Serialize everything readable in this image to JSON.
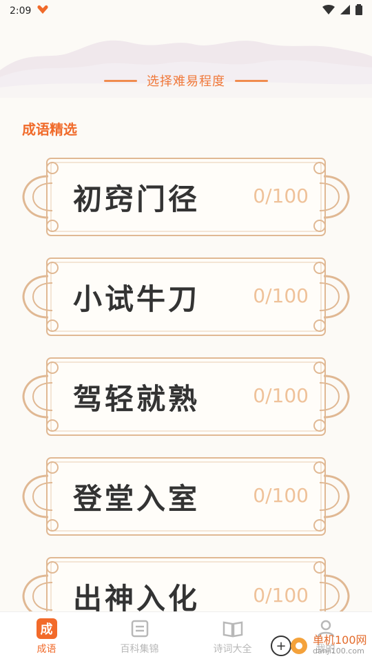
{
  "status": {
    "time": "2:09"
  },
  "header": {
    "difficulty_label": "选择难易程度"
  },
  "section": {
    "title": "成语精选"
  },
  "levels": [
    {
      "name": "初窍门径",
      "progress": "0/100"
    },
    {
      "name": "小试牛刀",
      "progress": "0/100"
    },
    {
      "name": "驾轻就熟",
      "progress": "0/100"
    },
    {
      "name": "登堂入室",
      "progress": "0/100"
    },
    {
      "name": "出神入化",
      "progress": "0/100"
    }
  ],
  "tabs": [
    {
      "label": "成语",
      "icon_text": "成",
      "icon": "idiom-icon",
      "active": true
    },
    {
      "label": "百科集锦",
      "icon": "encyclopedia-icon",
      "active": false
    },
    {
      "label": "诗词大全",
      "icon": "book-icon",
      "active": false
    },
    {
      "label": "我的",
      "icon": "user-icon",
      "active": false
    }
  ],
  "watermark": {
    "text": "单机100网",
    "url": "danji100.com"
  },
  "colors": {
    "accent": "#f06a2a",
    "frame": "#e0b893",
    "progress": "#efc29a"
  }
}
